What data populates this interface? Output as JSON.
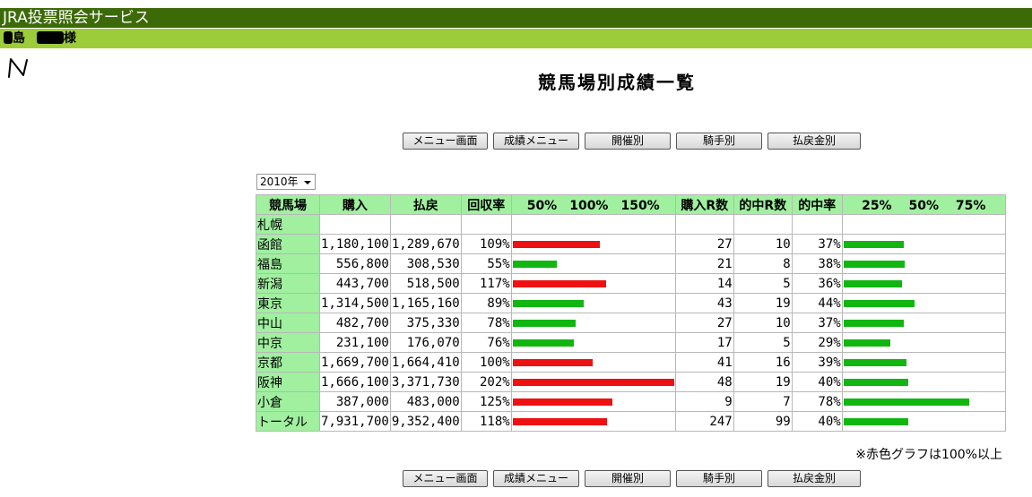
{
  "header": {
    "service_title": "JRA投票照会サービス",
    "user_prefix": "島",
    "user_suffix": "様"
  },
  "page_title": "競馬場別成績一覧",
  "nav_buttons": [
    "メニュー画面",
    "成績メニュー",
    "開催別",
    "騎手別",
    "払戻金別"
  ],
  "year_select": {
    "value": "2010年"
  },
  "table": {
    "headers": {
      "venue": "競馬場",
      "purchase": "購入",
      "payout": "払戻",
      "return_rate": "回収率",
      "return_scale": "50%　100%　150%",
      "races_bought": "購入R数",
      "races_hit": "的中R数",
      "hit_rate": "的中率",
      "hit_scale": "25%　 50%　 75%"
    },
    "rows": [
      {
        "venue": "札幌",
        "purchase": "",
        "payout": "",
        "return_rate": "",
        "return_pct": 0,
        "races_bought": "",
        "races_hit": "",
        "hit_rate": "",
        "hit_pct": 0
      },
      {
        "venue": "函館",
        "purchase": "1,180,100",
        "payout": "1,289,670",
        "return_rate": "109%",
        "return_pct": 109,
        "races_bought": "27",
        "races_hit": "10",
        "hit_rate": "37%",
        "hit_pct": 37
      },
      {
        "venue": "福島",
        "purchase": "556,800",
        "payout": "308,530",
        "return_rate": "55%",
        "return_pct": 55,
        "races_bought": "21",
        "races_hit": "8",
        "hit_rate": "38%",
        "hit_pct": 38
      },
      {
        "venue": "新潟",
        "purchase": "443,700",
        "payout": "518,500",
        "return_rate": "117%",
        "return_pct": 117,
        "races_bought": "14",
        "races_hit": "5",
        "hit_rate": "36%",
        "hit_pct": 36
      },
      {
        "venue": "東京",
        "purchase": "1,314,500",
        "payout": "1,165,160",
        "return_rate": "89%",
        "return_pct": 89,
        "races_bought": "43",
        "races_hit": "19",
        "hit_rate": "44%",
        "hit_pct": 44
      },
      {
        "venue": "中山",
        "purchase": "482,700",
        "payout": "375,330",
        "return_rate": "78%",
        "return_pct": 78,
        "races_bought": "27",
        "races_hit": "10",
        "hit_rate": "37%",
        "hit_pct": 37
      },
      {
        "venue": "中京",
        "purchase": "231,100",
        "payout": "176,070",
        "return_rate": "76%",
        "return_pct": 76,
        "races_bought": "17",
        "races_hit": "5",
        "hit_rate": "29%",
        "hit_pct": 29
      },
      {
        "venue": "京都",
        "purchase": "1,669,700",
        "payout": "1,664,410",
        "return_rate": "100%",
        "return_pct": 100,
        "races_bought": "41",
        "races_hit": "16",
        "hit_rate": "39%",
        "hit_pct": 39
      },
      {
        "venue": "阪神",
        "purchase": "1,666,100",
        "payout": "3,371,730",
        "return_rate": "202%",
        "return_pct": 202,
        "races_bought": "48",
        "races_hit": "19",
        "hit_rate": "40%",
        "hit_pct": 40
      },
      {
        "venue": "小倉",
        "purchase": "387,000",
        "payout": "483,000",
        "return_rate": "125%",
        "return_pct": 125,
        "races_bought": "9",
        "races_hit": "7",
        "hit_rate": "78%",
        "hit_pct": 78
      },
      {
        "venue": "トータル",
        "purchase": "7,931,700",
        "payout": "9,352,400",
        "return_rate": "118%",
        "return_pct": 118,
        "races_bought": "247",
        "races_hit": "99",
        "hit_rate": "40%",
        "hit_pct": 40
      }
    ]
  },
  "note": "※赤色グラフは100%以上",
  "colors": {
    "over_100": "#ee1111",
    "under_100": "#11b611",
    "header_bg": "#a0f0a0",
    "top_bar": "#3c6a08",
    "user_bar": "#9ccc3a"
  }
}
